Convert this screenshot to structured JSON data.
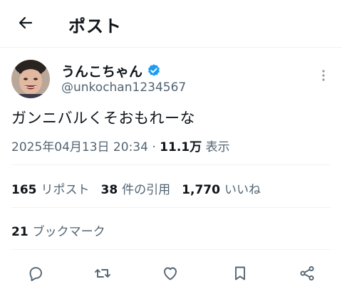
{
  "header": {
    "back_icon": "arrow-left-icon",
    "title": "ポスト"
  },
  "author": {
    "display_name": "うんこちゃん",
    "handle": "@unkochan1234567",
    "verified_icon": "verified-badge-icon",
    "verified_color": "#1d9bf0"
  },
  "tweet": {
    "text": "ガンニバルくそおもれーな",
    "timestamp": "2025年04月13日 20:34",
    "separator": "·",
    "views_count": "11.1万",
    "views_label": "表示"
  },
  "stats": {
    "reposts_count": "165",
    "reposts_label": "リポスト",
    "quotes_count": "38",
    "quotes_label": "件の引用",
    "likes_count": "1,770",
    "likes_label": "いいね",
    "bookmarks_count": "21",
    "bookmarks_label": "ブックマーク"
  },
  "actions": [
    "reply-icon",
    "repost-icon",
    "like-icon",
    "bookmark-icon",
    "share-icon"
  ],
  "colors": {
    "text": "#0f1419",
    "secondary": "#536471",
    "divider": "#eff3f4",
    "accent": "#1d9bf0"
  }
}
